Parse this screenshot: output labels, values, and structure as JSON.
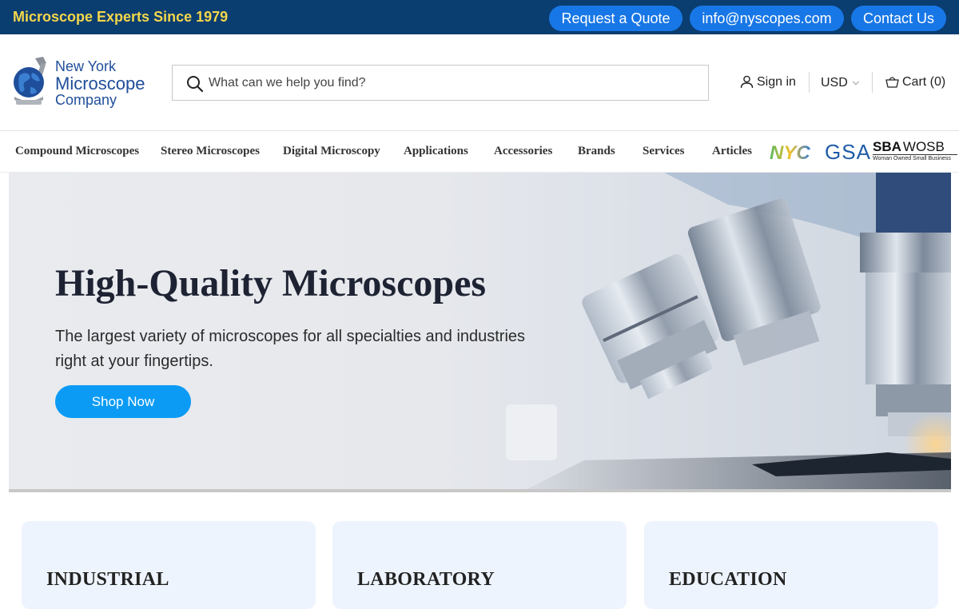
{
  "topbar": {
    "tagline": "Microscope Experts Since 1979",
    "quote_label": "Request a Quote",
    "email_label": "info@nyscopes.com",
    "contact_label": "Contact Us",
    "background": "#0a3d70",
    "tagline_color": "#f3d64b",
    "pill_color": "#1877e6"
  },
  "header": {
    "logo": {
      "line1": "New York",
      "line2": "Microscope",
      "line3": "Company"
    },
    "search": {
      "placeholder": "What can we help you find?",
      "icon": "search-icon"
    },
    "signin_label": "Sign in",
    "currency": "USD",
    "cart_label": "Cart (0)"
  },
  "nav": {
    "items": [
      {
        "label": "Compound Microscopes"
      },
      {
        "label": "Stereo Microscopes"
      },
      {
        "label": "Digital Microscopy"
      },
      {
        "label": "Applications"
      },
      {
        "label": "Accessories"
      },
      {
        "label": "Brands"
      },
      {
        "label": "Services"
      },
      {
        "label": "Articles"
      }
    ],
    "badges": {
      "nyc": "NYC",
      "gsa": "GSA",
      "sba": "SBA",
      "wosb": "WOSB",
      "wosb_caption": "Woman Owned Small Business"
    }
  },
  "hero": {
    "title": "High-Quality Microscopes",
    "subtitle": "The largest variety of microscopes for all specialties and industries right at your fingertips.",
    "button_label": "Shop Now",
    "button_color": "#0b9bf5"
  },
  "categories": [
    {
      "label": "INDUSTRIAL"
    },
    {
      "label": "LABORATORY"
    },
    {
      "label": "EDUCATION"
    }
  ]
}
